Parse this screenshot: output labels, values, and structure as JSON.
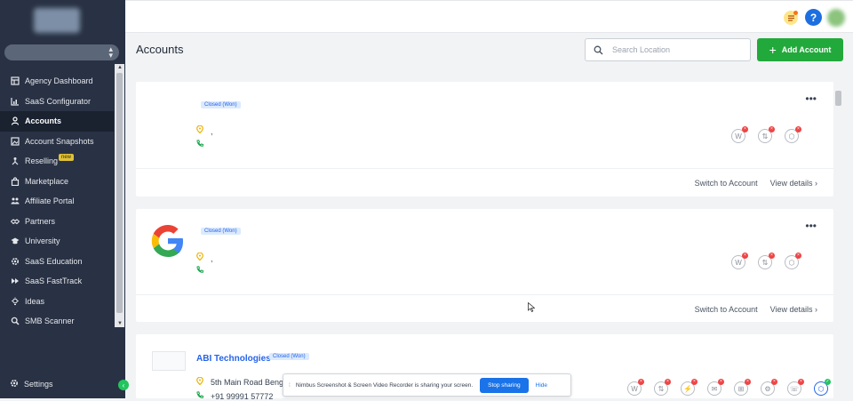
{
  "sidebar": {
    "items": [
      {
        "label": "Agency Dashboard",
        "icon": "dashboard-icon"
      },
      {
        "label": "SaaS Configurator",
        "icon": "chart-icon"
      },
      {
        "label": "Accounts",
        "icon": "user-icon",
        "active": true
      },
      {
        "label": "Account Snapshots",
        "icon": "snapshot-icon"
      },
      {
        "label": "Reselling",
        "icon": "reselling-icon",
        "badge": "new"
      },
      {
        "label": "Marketplace",
        "icon": "bag-icon"
      },
      {
        "label": "Affiliate Portal",
        "icon": "users-icon"
      },
      {
        "label": "Partners",
        "icon": "handshake-icon"
      },
      {
        "label": "University",
        "icon": "graduation-icon"
      },
      {
        "label": "SaaS Education",
        "icon": "gear-icon"
      },
      {
        "label": "SaaS FastTrack",
        "icon": "fast-forward-icon"
      },
      {
        "label": "Ideas",
        "icon": "lightbulb-icon"
      },
      {
        "label": "SMB Scanner",
        "icon": "search-icon"
      }
    ],
    "settings_label": "Settings"
  },
  "header": {
    "help": "?"
  },
  "main": {
    "title": "Accounts",
    "search_placeholder": "Search Location",
    "add_button": "Add Account"
  },
  "accounts": [
    {
      "name": "",
      "status": "Closed (Won)",
      "address": ",",
      "phone": "",
      "switch_label": "Switch to Account",
      "details_label": "View details"
    },
    {
      "name": "",
      "status": "Closed (Won)",
      "address": ",",
      "phone": "",
      "switch_label": "Switch to Account",
      "details_label": "View details"
    },
    {
      "name": "ABI Technologies",
      "status": "Closed (Won)",
      "address": "5th Main Road Benga",
      "phone": "+91 99991 57772"
    }
  ],
  "share_bar": {
    "message": "Nimbus Screenshot & Screen Video Recorder is sharing your screen.",
    "stop_label": "Stop sharing",
    "hide_label": "Hide"
  },
  "colors": {
    "sidebar_bg": "#293244",
    "accent_green": "#22a93b",
    "status_bg": "#dbeafe",
    "status_text": "#2563eb",
    "help_blue": "#1d6fe0"
  }
}
